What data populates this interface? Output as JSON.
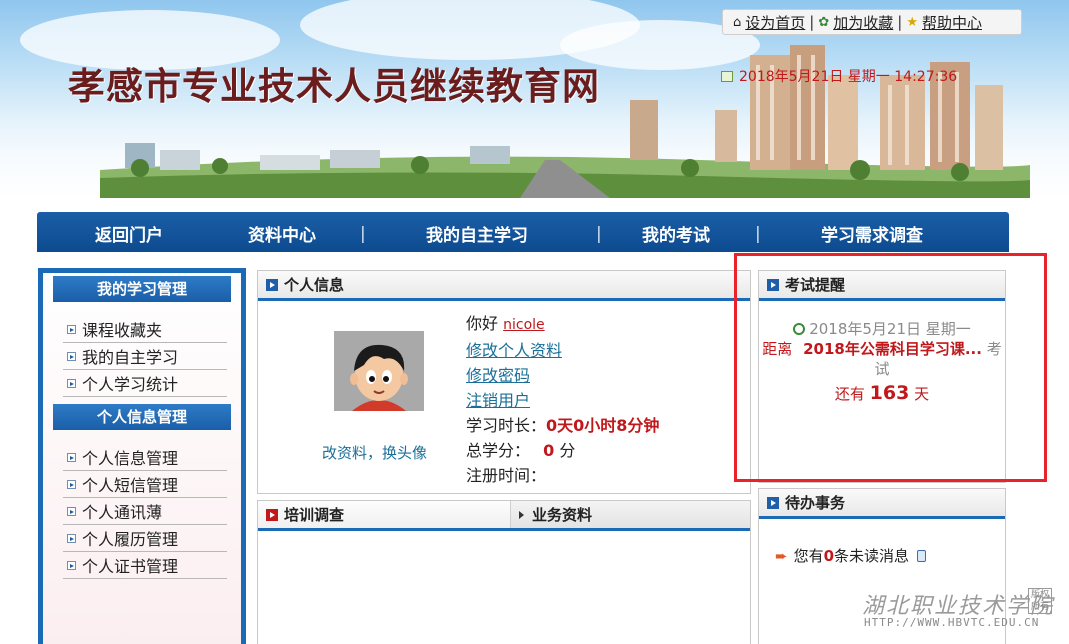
{
  "header": {
    "site_title": "孝感市专业技术人员继续教育网",
    "links": [
      {
        "label": "设为首页",
        "icon": "home-icon"
      },
      {
        "label": "加为收藏",
        "icon": "favorite-icon"
      },
      {
        "label": "帮助中心",
        "icon": "star-icon"
      }
    ],
    "datetime": "2018年5月21日 星期一 14:27:36"
  },
  "nav": {
    "items": [
      "返回门户",
      "资料中心",
      "我的自主学习",
      "我的考试",
      "学习需求调查"
    ],
    "separator": "|"
  },
  "sidebar": {
    "sections": [
      {
        "title": "我的学习管理",
        "items": [
          "课程收藏夹",
          "我的自主学习",
          "个人学习统计"
        ]
      },
      {
        "title": "个人信息管理",
        "items": [
          "个人信息管理",
          "个人短信管理",
          "个人通讯薄",
          "个人履历管理",
          "个人证书管理"
        ]
      }
    ]
  },
  "personal_info": {
    "title": "个人信息",
    "greeting": "你好",
    "username": "nicole",
    "links": [
      "修改个人资料",
      "修改密码",
      "注销用户"
    ],
    "study_time_label": "学习时长：",
    "study_time_value": "0天0小时8分钟",
    "credits_label": "总学分：",
    "credits_value": "0",
    "credits_unit": "分",
    "register_label": "注册时间：",
    "avatar_caption": "改资料，换头像"
  },
  "exam_reminder": {
    "title": "考试提醒",
    "date": "2018年5月21日 星期一",
    "prefix": "距离",
    "exam_name": "2018年公需科目学习课...",
    "suffix": "考试",
    "remain_prefix": "还有",
    "days": "163",
    "remain_suffix": "天"
  },
  "tabs": {
    "active": "培训调查",
    "other": "业务资料"
  },
  "todo": {
    "title": "待办事务",
    "text_before": "您有",
    "count": "0",
    "text_after": "条未读消息"
  },
  "watermark": {
    "name": "湖北职业技术学院",
    "seal": "版权所有",
    "url": "HTTP://WWW.HBVTC.EDU.CN"
  },
  "colors": {
    "nav_blue": "#0d4b90",
    "accent_red": "#c0181b",
    "link_teal": "#1a6f98",
    "highlight_red": "#e8232a"
  }
}
